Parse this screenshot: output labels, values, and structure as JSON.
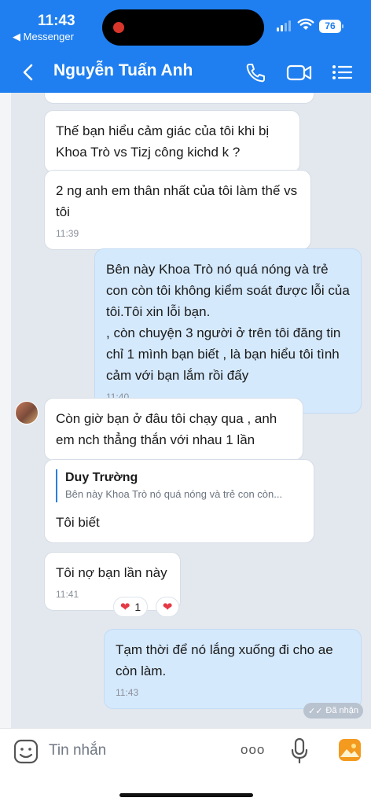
{
  "status_bar": {
    "time": "11:43",
    "back_app": "◀ Messenger",
    "battery": "76"
  },
  "header": {
    "contact_name": "Nguyễn Tuấn Anh"
  },
  "messages": [
    {
      "text": "Thế bạn hiểu cảm giác của tôi khi bị Khoa Trò vs Tizj công kichd k ?"
    },
    {
      "text": "2 ng anh em thân nhất của tôi làm thế vs tôi",
      "time": "11:39"
    },
    {
      "text": "Bên này Khoa Trò nó quá nóng và trẻ con còn tôi không kiểm soát được lỗi của tôi.Tôi xin lỗi bạn.\n, còn chuyện 3 người ở trên tôi đăng tin chỉ 1 mình bạn biết , là bạn hiểu tôi tình cảm với bạn lắm rồi đấy",
      "time": "11:40"
    },
    {
      "text": "Còn giờ bạn ở đâu tôi chạy qua , anh em nch thẳng thắn với nhau 1 lần"
    },
    {
      "quote_name": "Duy Trường",
      "quote_text": "Bên này Khoa Trò nó quá nóng và trẻ con còn...",
      "text": "Tôi biết"
    },
    {
      "text": "Tôi nợ bạn lần này",
      "time": "11:41",
      "reaction_count": "1"
    },
    {
      "text": "Tạm thời để nó lắng xuống đi cho ae còn làm.",
      "time": "11:43"
    }
  ],
  "seen_label": "Đã nhận",
  "composer": {
    "placeholder": "Tin nhắn",
    "more": "ooo"
  }
}
